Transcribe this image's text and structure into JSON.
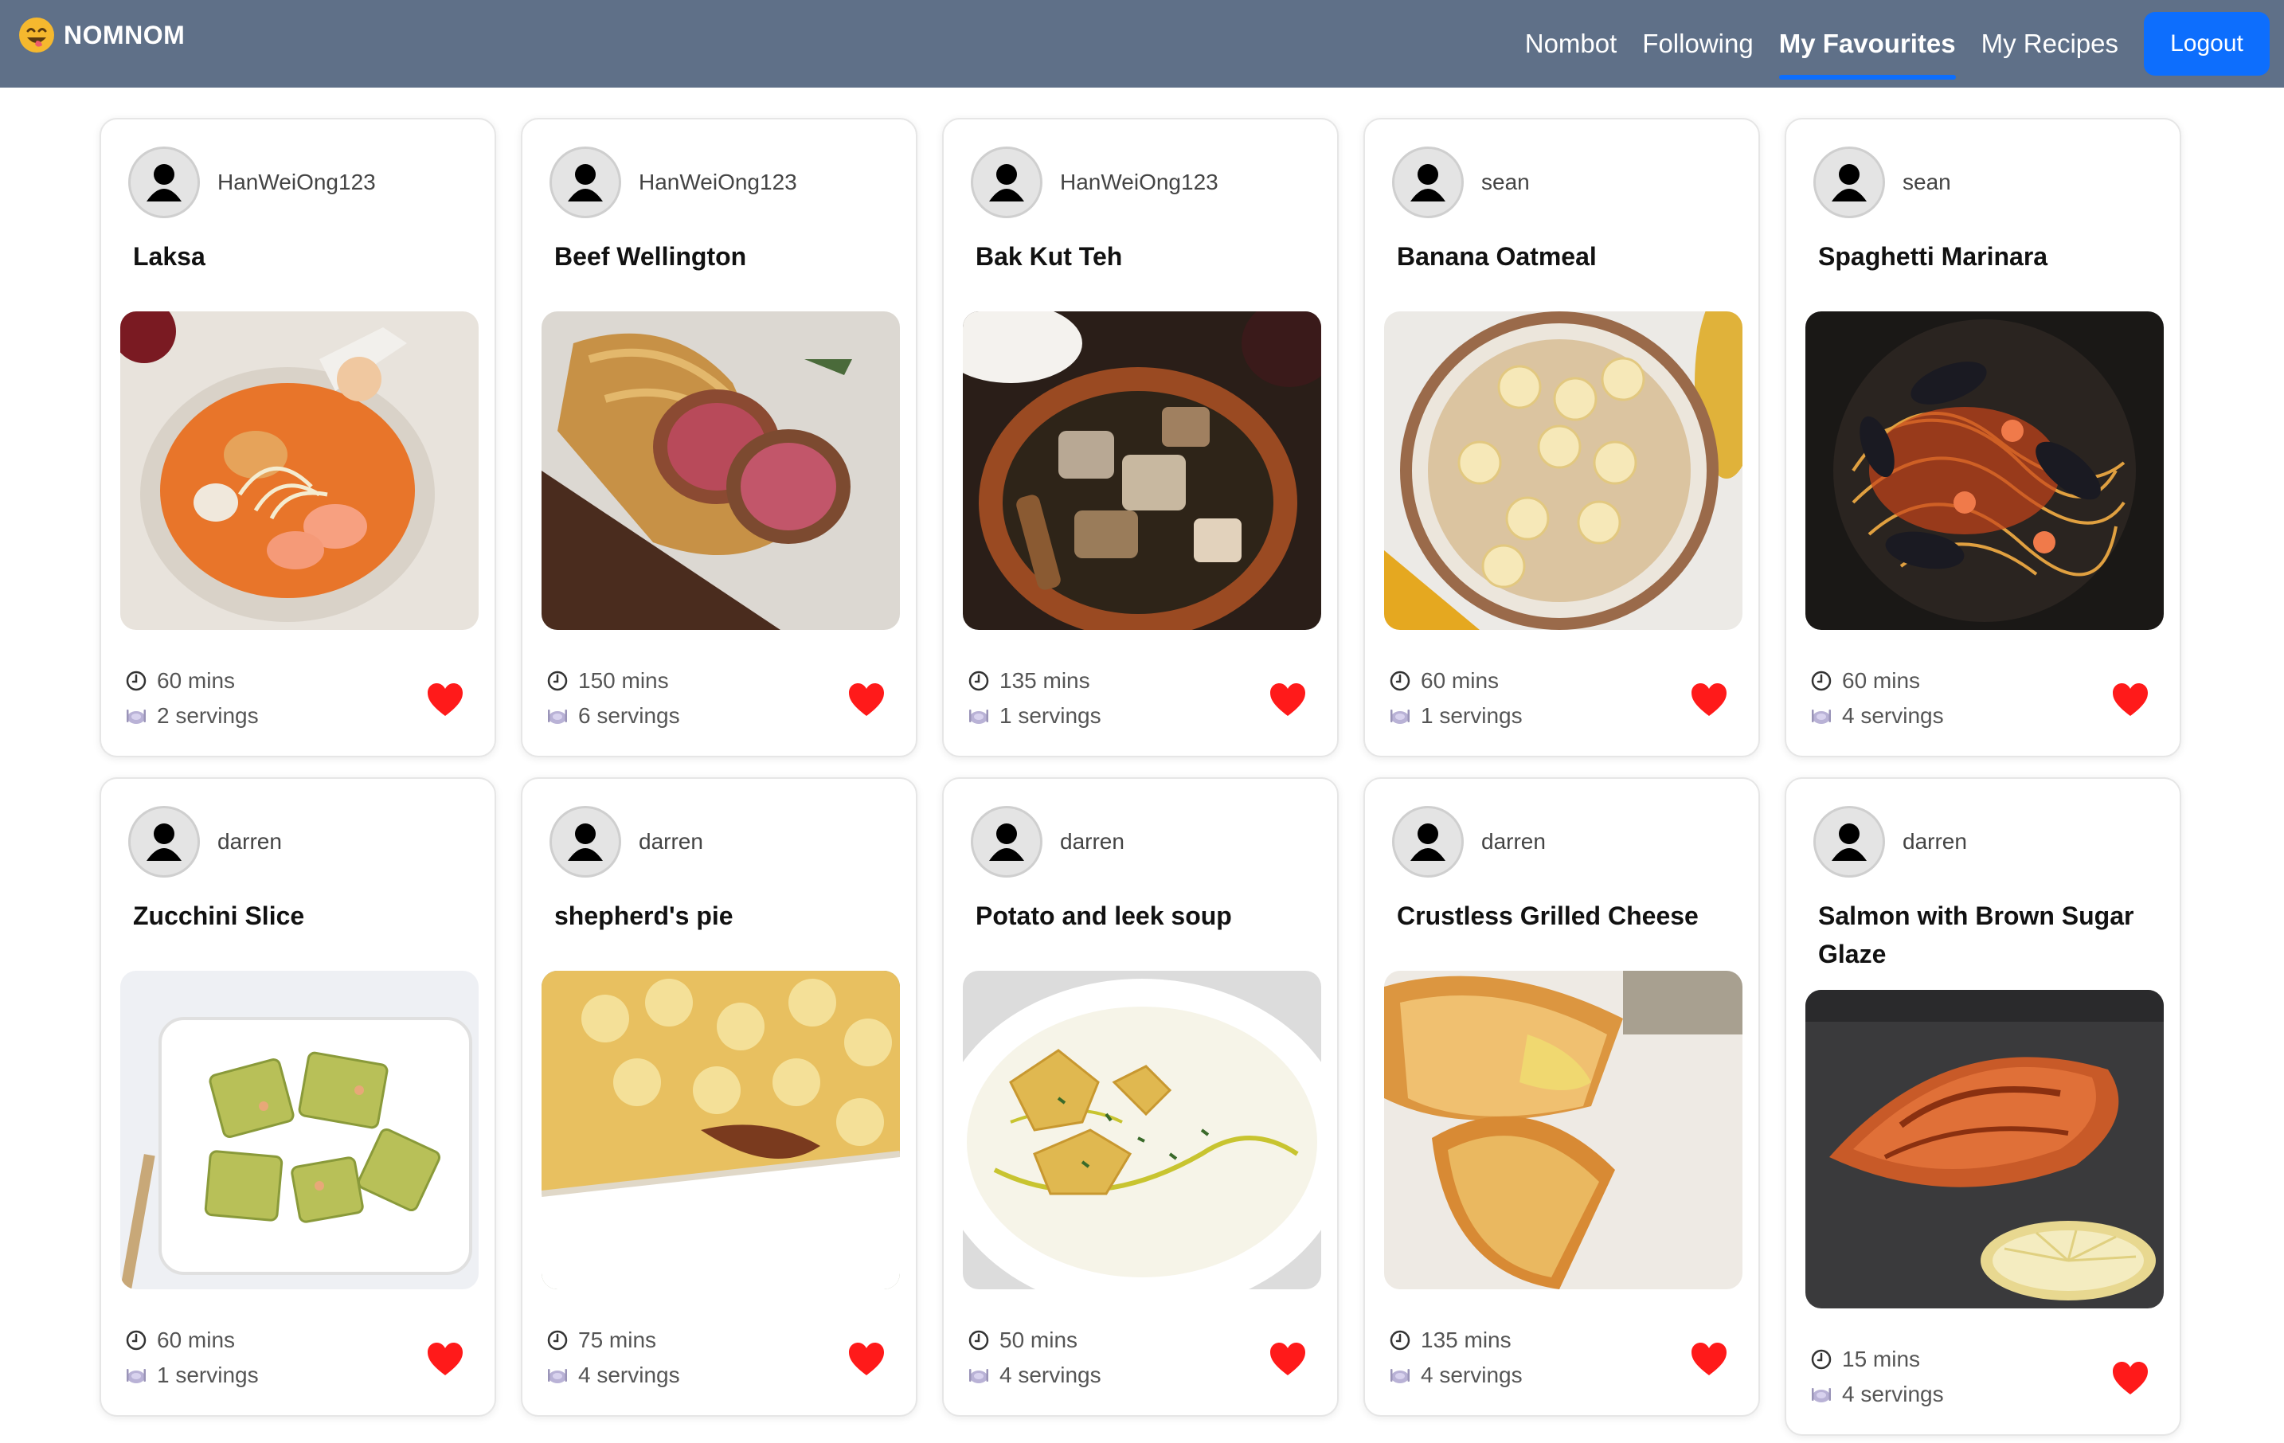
{
  "app": {
    "brand": "NOMNOM",
    "nav": [
      {
        "label": "Nombot",
        "active": false
      },
      {
        "label": "Following",
        "active": false
      },
      {
        "label": "My Favourites",
        "active": true
      },
      {
        "label": "My Recipes",
        "active": false
      }
    ],
    "logout_label": "Logout"
  },
  "colors": {
    "navbar": "#5f7088",
    "accent": "#0d6efd",
    "heart": "#ff1a1a"
  },
  "recipes": [
    {
      "author": "HanWeiOng123",
      "title": "Laksa",
      "time": "60 mins",
      "servings": "2 servings",
      "favourited": true
    },
    {
      "author": "HanWeiOng123",
      "title": "Beef Wellington",
      "time": "150 mins",
      "servings": "6 servings",
      "favourited": true
    },
    {
      "author": "HanWeiOng123",
      "title": "Bak Kut Teh",
      "time": "135 mins",
      "servings": "1 servings",
      "favourited": true
    },
    {
      "author": "sean",
      "title": "Banana Oatmeal",
      "time": "60 mins",
      "servings": "1 servings",
      "favourited": true
    },
    {
      "author": "sean",
      "title": "Spaghetti Marinara",
      "time": "60 mins",
      "servings": "4 servings",
      "favourited": true
    },
    {
      "author": "darren",
      "title": "Zucchini Slice",
      "time": "60 mins",
      "servings": "1 servings",
      "favourited": true
    },
    {
      "author": "darren",
      "title": "shepherd's pie",
      "time": "75 mins",
      "servings": "4 servings",
      "favourited": true
    },
    {
      "author": "darren",
      "title": "Potato and leek soup",
      "time": "50 mins",
      "servings": "4 servings",
      "favourited": true
    },
    {
      "author": "darren",
      "title": "Crustless Grilled Cheese",
      "time": "135 mins",
      "servings": "4 servings",
      "favourited": true
    },
    {
      "author": "darren",
      "title": "Salmon with Brown Sugar Glaze",
      "time": "15 mins",
      "servings": "4 servings",
      "favourited": true
    }
  ]
}
